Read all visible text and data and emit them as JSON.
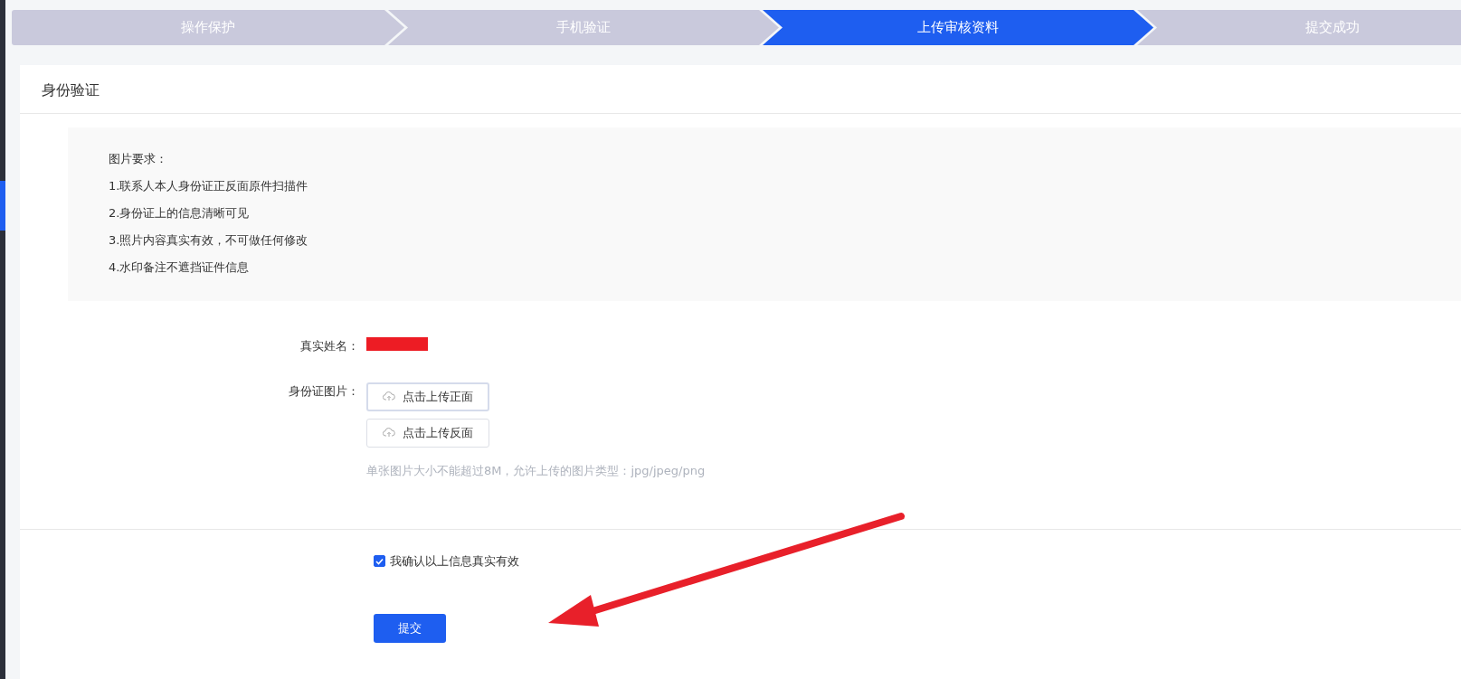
{
  "steps": [
    {
      "label": "操作保护",
      "selected": false
    },
    {
      "label": "手机验证",
      "selected": false
    },
    {
      "label": "上传审核资料",
      "selected": true
    },
    {
      "label": "提交成功",
      "selected": false
    }
  ],
  "section": {
    "title": "身份验证"
  },
  "requirements": {
    "title": "图片要求：",
    "items": [
      "1.联系人本人身份证正反面原件扫描件",
      "2.身份证上的信息清晰可见",
      "3.照片内容真实有效，不可做任何修改",
      "4.水印备注不遮挡证件信息"
    ]
  },
  "form": {
    "name_label": "真实姓名：",
    "id_label": "身份证图片：",
    "uploads": [
      {
        "label": "点击上传正面",
        "focused": true
      },
      {
        "label": "点击上传反面",
        "focused": false
      }
    ],
    "hint": "单张图片大小不能超过8M，允许上传的图片类型：jpg/jpeg/png"
  },
  "confirm": {
    "label": "我确认以上信息真实有效",
    "checked": true
  },
  "submit": {
    "label": "提交"
  }
}
